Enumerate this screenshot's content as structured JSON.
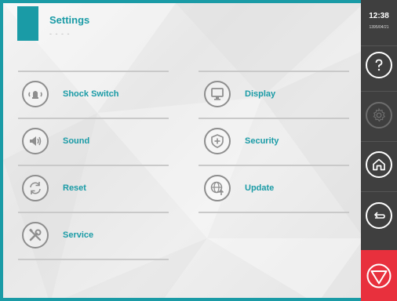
{
  "header": {
    "title": "Settings",
    "subtitle": "- - - -"
  },
  "menu": {
    "shock_switch": "Shock Switch",
    "display": "Display",
    "sound": "Sound",
    "security": "Security",
    "reset": "Reset",
    "update": "Update",
    "service": "Service"
  },
  "sidebar": {
    "time": "12:38",
    "date": "1395/04/21"
  },
  "colors": {
    "accent": "#1a9ba6",
    "sidebar": "#3f3f3f",
    "stop": "#e8303d"
  }
}
